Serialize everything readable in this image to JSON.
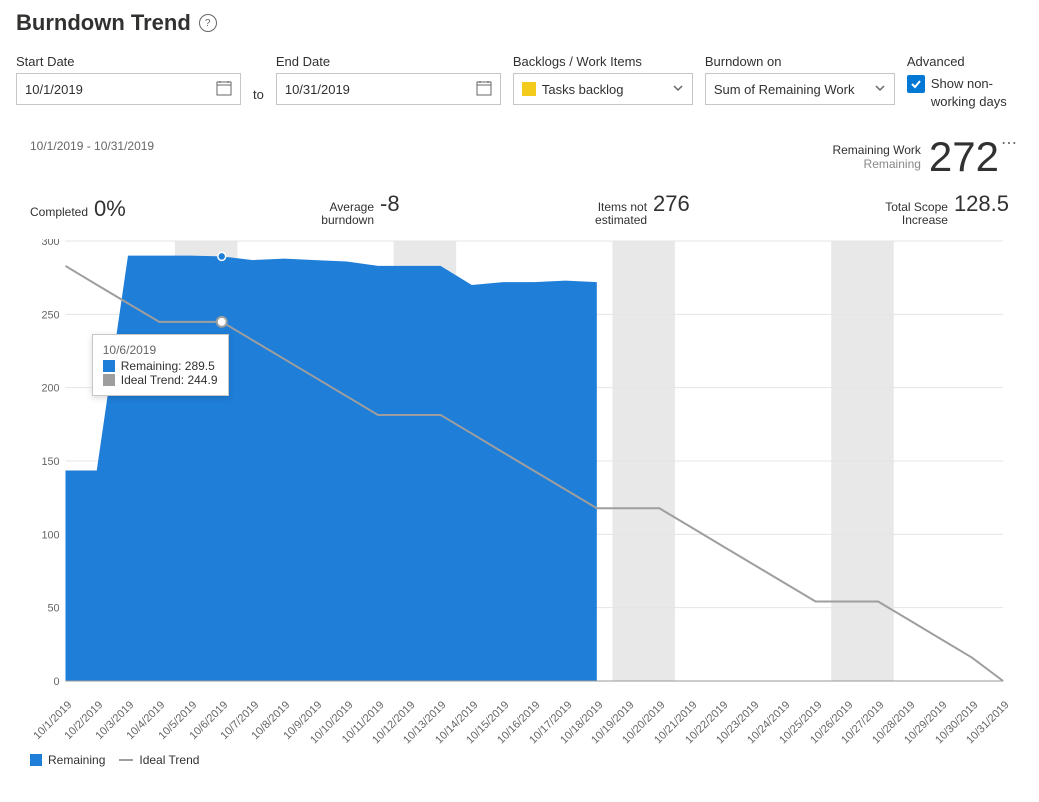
{
  "title": "Burndown Trend",
  "labels": {
    "start_date": "Start Date",
    "end_date": "End Date",
    "to": "to",
    "backlogs": "Backlogs / Work Items",
    "burndown_on": "Burndown on",
    "advanced": "Advanced",
    "show_non_working": "Show non-working days"
  },
  "inputs": {
    "start_date": "10/1/2019",
    "end_date": "10/31/2019",
    "backlogs": "Tasks backlog",
    "burndown_on": "Sum of Remaining Work"
  },
  "date_range": "10/1/2019 - 10/31/2019",
  "metrics": {
    "remaining_work_lbl": "Remaining Work",
    "remaining_sub": "Remaining",
    "remaining_val": "272",
    "completed_lbl": "Completed",
    "completed_val": "0%",
    "avg_lbl_1": "Average",
    "avg_lbl_2": "burndown",
    "avg_val": "-8",
    "items_lbl_1": "Items not",
    "items_lbl_2": "estimated",
    "items_val": "276",
    "scope_lbl_1": "Total Scope",
    "scope_lbl_2": "Increase",
    "scope_val": "128.5"
  },
  "tooltip": {
    "date": "10/6/2019",
    "line1_lbl": "Remaining: 289.5",
    "line2_lbl": "Ideal Trend: 244.9"
  },
  "legend": {
    "remaining": "Remaining",
    "ideal": "Ideal Trend"
  },
  "chart_data": {
    "type": "area",
    "title": "Burndown Trend",
    "xlabel": "",
    "ylabel": "",
    "ylim": [
      0,
      300
    ],
    "yticks": [
      0,
      50,
      100,
      150,
      200,
      250,
      300
    ],
    "categories": [
      "10/1/2019",
      "10/2/2019",
      "10/3/2019",
      "10/4/2019",
      "10/5/2019",
      "10/6/2019",
      "10/7/2019",
      "10/8/2019",
      "10/9/2019",
      "10/10/2019",
      "10/11/2019",
      "10/12/2019",
      "10/13/2019",
      "10/14/2019",
      "10/15/2019",
      "10/16/2019",
      "10/17/2019",
      "10/18/2019",
      "10/19/2019",
      "10/20/2019",
      "10/21/2019",
      "10/22/2019",
      "10/23/2019",
      "10/24/2019",
      "10/25/2019",
      "10/26/2019",
      "10/27/2019",
      "10/28/2019",
      "10/29/2019",
      "10/30/2019",
      "10/31/2019"
    ],
    "non_working_days": [
      "10/5/2019",
      "10/6/2019",
      "10/12/2019",
      "10/13/2019",
      "10/19/2019",
      "10/20/2019",
      "10/26/2019",
      "10/27/2019"
    ],
    "series": [
      {
        "name": "Remaining",
        "values": [
          143.5,
          143.5,
          290,
          290,
          290,
          289.5,
          287,
          288,
          287,
          286,
          283,
          283,
          283,
          270,
          272,
          272,
          273,
          272,
          null,
          null,
          null,
          null,
          null,
          null,
          null,
          null,
          null,
          null,
          null,
          null,
          null
        ]
      },
      {
        "name": "Ideal Trend",
        "values": [
          283,
          270.2,
          257.5,
          244.9,
          244.9,
          244.9,
          232.2,
          219.5,
          206.8,
          194.1,
          181.4,
          181.4,
          181.4,
          168.7,
          155.9,
          143.2,
          130.5,
          117.8,
          117.8,
          117.8,
          105.1,
          92.3,
          79.6,
          66.9,
          54.2,
          54.2,
          54.2,
          41.5,
          28.7,
          16.0,
          0
        ]
      }
    ],
    "focus": {
      "date": "10/6/2019",
      "remaining": 289.5,
      "ideal": 244.9
    }
  }
}
